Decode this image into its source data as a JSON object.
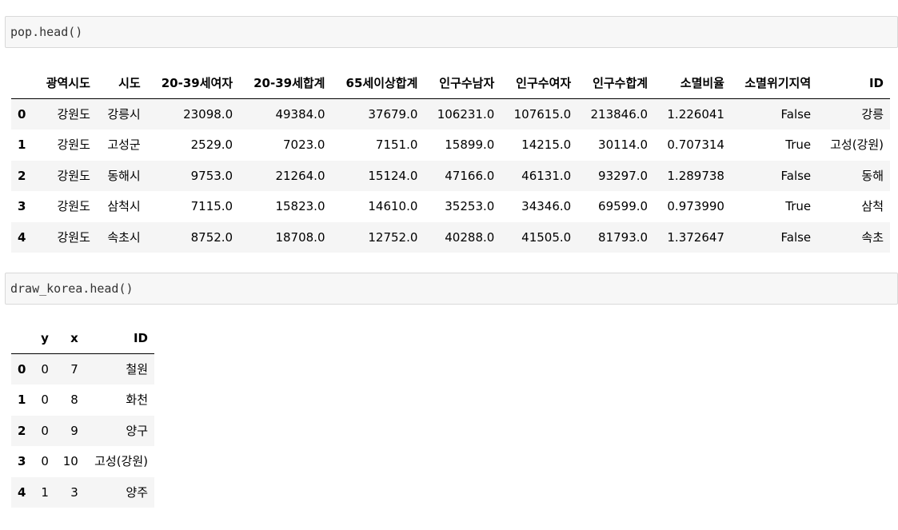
{
  "cell1": {
    "code": "pop.head()"
  },
  "cell2": {
    "code": "draw_korea.head()"
  },
  "pop_table": {
    "columns": [
      "광역시도",
      "시도",
      "20-39세여자",
      "20-39세합계",
      "65세이상합계",
      "인구수남자",
      "인구수여자",
      "인구수합계",
      "소멸비율",
      "소멸위기지역",
      "ID"
    ],
    "rows": [
      {
        "index": "0",
        "cells": [
          "강원도",
          "강릉시",
          "23098.0",
          "49384.0",
          "37679.0",
          "106231.0",
          "107615.0",
          "213846.0",
          "1.226041",
          "False",
          "강릉"
        ]
      },
      {
        "index": "1",
        "cells": [
          "강원도",
          "고성군",
          "2529.0",
          "7023.0",
          "7151.0",
          "15899.0",
          "14215.0",
          "30114.0",
          "0.707314",
          "True",
          "고성(강원)"
        ]
      },
      {
        "index": "2",
        "cells": [
          "강원도",
          "동해시",
          "9753.0",
          "21264.0",
          "15124.0",
          "47166.0",
          "46131.0",
          "93297.0",
          "1.289738",
          "False",
          "동해"
        ]
      },
      {
        "index": "3",
        "cells": [
          "강원도",
          "삼척시",
          "7115.0",
          "15823.0",
          "14610.0",
          "35253.0",
          "34346.0",
          "69599.0",
          "0.973990",
          "True",
          "삼척"
        ]
      },
      {
        "index": "4",
        "cells": [
          "강원도",
          "속초시",
          "8752.0",
          "18708.0",
          "12752.0",
          "40288.0",
          "41505.0",
          "81793.0",
          "1.372647",
          "False",
          "속초"
        ]
      }
    ]
  },
  "draw_table": {
    "columns": [
      "y",
      "x",
      "ID"
    ],
    "rows": [
      {
        "index": "0",
        "cells": [
          "0",
          "7",
          "철원"
        ]
      },
      {
        "index": "1",
        "cells": [
          "0",
          "8",
          "화천"
        ]
      },
      {
        "index": "2",
        "cells": [
          "0",
          "9",
          "양구"
        ]
      },
      {
        "index": "3",
        "cells": [
          "0",
          "10",
          "고성(강원)"
        ]
      },
      {
        "index": "4",
        "cells": [
          "1",
          "3",
          "양주"
        ]
      }
    ]
  }
}
